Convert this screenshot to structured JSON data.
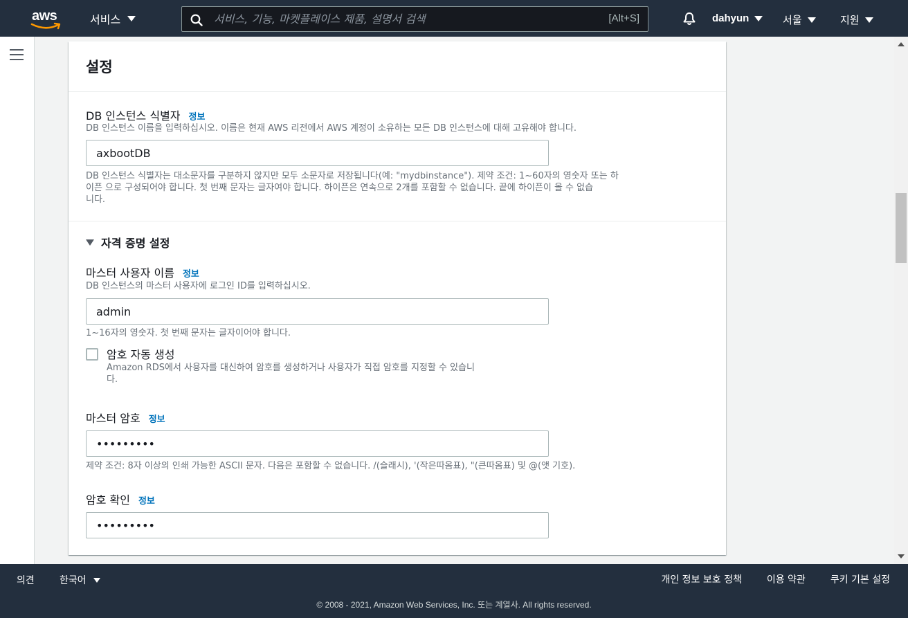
{
  "nav": {
    "logo": "aws",
    "services": "서비스",
    "search_placeholder": "서비스, 기능, 마켓플레이스 제품, 설명서 검색",
    "search_shortcut": "[Alt+S]",
    "user": "dahyun",
    "region": "서울",
    "support": "지원"
  },
  "card": {
    "title": "설정",
    "db_identifier": {
      "label": "DB 인스턴스 식별자",
      "info": "정보",
      "description": "DB 인스턴스 이름을 입력하십시오. 이름은 현재 AWS 리전에서 AWS 계정이 소유하는 모든 DB 인스턴스에 대해 고유해야 합니다.",
      "value": "axbootDB",
      "hint_line1": "DB 인스턴스 식별자는 대소문자를 구분하지 않지만 모두 소문자로 저장됩니다(예: \"mydbinstance\"). 제약 조건: 1~60자의 영숫자 또는 하",
      "hint_line2": "이픈 으로 구성되어야 합니다. 첫 번째 문자는 글자여야 합니다. 하이픈은 연속으로 2개를 포함할 수 없습니다. 끝에 하이픈이 올 수 없습",
      "hint_line3": "니다."
    },
    "credentials": {
      "section_title": "자격 증명 설정",
      "master_user": {
        "label": "마스터 사용자 이름",
        "info": "정보",
        "description": "DB 인스턴스의 마스터 사용자에 로그인 ID를 입력하십시오.",
        "value": "admin",
        "hint": "1~16자의 영숫자. 첫 번째 문자는 글자이어야 합니다."
      },
      "auto_password": {
        "label": "암호 자동 생성",
        "checked": false,
        "description_line1": "Amazon RDS에서 사용자를 대신하여 암호를 생성하거나 사용자가 직접 암호를 지정할 수 있습니",
        "description_line2": "다."
      },
      "master_password": {
        "label": "마스터 암호",
        "info": "정보",
        "value": "•••••••••",
        "hint": "제약 조건: 8자 이상의 인쇄 가능한 ASCII 문자. 다음은 포함할 수 없습니다. /(슬래시), '(작은따옴표), \"(큰따옴표) 및 @(앳 기호)."
      },
      "confirm_password": {
        "label": "암호 확인",
        "info": "정보",
        "value": "•••••••••"
      }
    }
  },
  "footer": {
    "feedback": "의견",
    "language": "한국어",
    "privacy": "개인 정보 보호 정책",
    "terms": "이용 약관",
    "cookies": "쿠키 기본 설정",
    "copyright": "© 2008 - 2021, Amazon Web Services, Inc. 또는 계열사. All rights reserved."
  },
  "colors": {
    "nav_bg": "#232f3e",
    "link": "#0073bb",
    "page_bg": "#f2f3f3"
  }
}
